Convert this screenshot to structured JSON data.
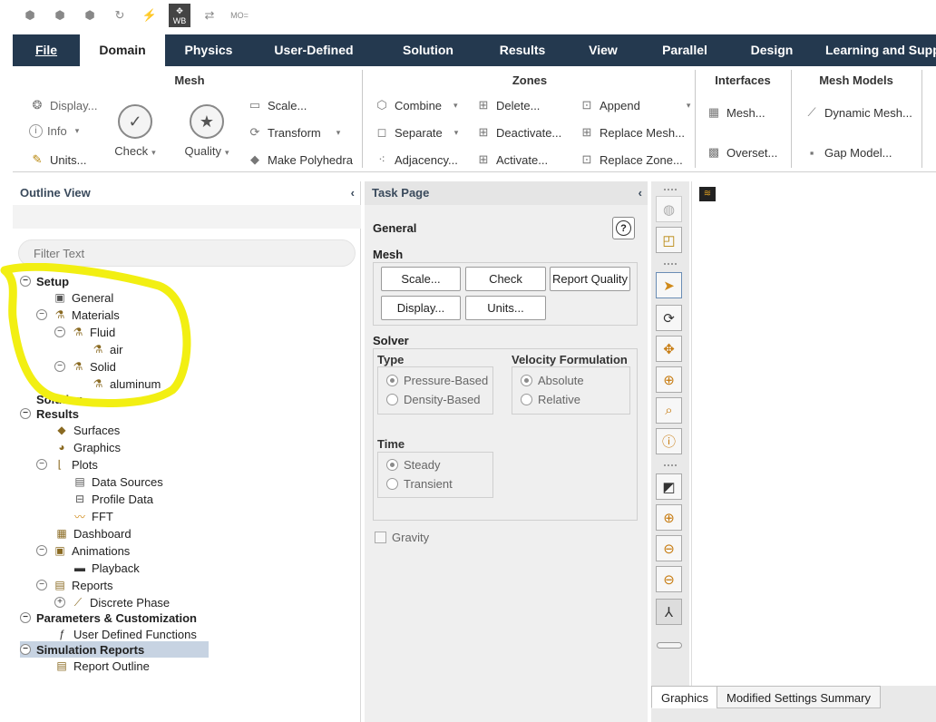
{
  "quick_access": {
    "icons": [
      "new-case-icon",
      "open-case-icon",
      "save-case-icon",
      "refresh-icon",
      "reduce-icon",
      "workbench-icon",
      "layout-icon",
      "moe-icon"
    ],
    "wb_label": "WB",
    "moe_label": "MO="
  },
  "tabs": [
    {
      "label": "File",
      "active": false
    },
    {
      "label": "Domain",
      "active": true
    },
    {
      "label": "Physics",
      "active": false
    },
    {
      "label": "User-Defined",
      "active": false
    },
    {
      "label": "Solution",
      "active": false
    },
    {
      "label": "Results",
      "active": false
    },
    {
      "label": "View",
      "active": false
    },
    {
      "label": "Parallel",
      "active": false
    },
    {
      "label": "Design",
      "active": false
    },
    {
      "label": "Learning and Support",
      "active": false
    }
  ],
  "ribbon": {
    "mesh": {
      "title": "Mesh",
      "display": "Display...",
      "info": "Info",
      "units": "Units...",
      "check": "Check",
      "quality": "Quality",
      "scale": "Scale...",
      "transform": "Transform",
      "make_polyhedra": "Make Polyhedra"
    },
    "zones": {
      "title": "Zones",
      "combine": "Combine",
      "separate": "Separate",
      "adjacency": "Adjacency...",
      "delete": "Delete...",
      "deactivate": "Deactivate...",
      "activate": "Activate...",
      "append": "Append",
      "replace_mesh": "Replace Mesh...",
      "replace_zone": "Replace Zone..."
    },
    "interfaces": {
      "title": "Interfaces",
      "mesh": "Mesh...",
      "overset": "Overset..."
    },
    "mesh_models": {
      "title": "Mesh Models",
      "dynamic_mesh": "Dynamic Mesh...",
      "gap_model": "Gap Model..."
    }
  },
  "outline": {
    "title": "Outline View",
    "filter_placeholder": "Filter Text",
    "tree": {
      "setup": "Setup",
      "general": "General",
      "materials": "Materials",
      "fluid": "Fluid",
      "air": "air",
      "solid": "Solid",
      "aluminum": "aluminum",
      "solution": "Solution",
      "results": "Results",
      "surfaces": "Surfaces",
      "graphics": "Graphics",
      "plots": "Plots",
      "data_sources": "Data Sources",
      "profile_data": "Profile Data",
      "fft": "FFT",
      "dashboard": "Dashboard",
      "animations": "Animations",
      "playback": "Playback",
      "reports": "Reports",
      "discrete_phase": "Discrete Phase",
      "params": "Parameters & Customization",
      "udf": "User Defined Functions",
      "sim_reports": "Simulation Reports",
      "report_outline": "Report Outline"
    }
  },
  "task_page": {
    "title": "Task Page",
    "heading": "General",
    "help": "?",
    "mesh_label": "Mesh",
    "buttons": {
      "scale": "Scale...",
      "check": "Check",
      "report_quality": "Report Quality",
      "display": "Display...",
      "units": "Units..."
    },
    "solver_label": "Solver",
    "type_label": "Type",
    "pressure_based": "Pressure-Based",
    "density_based": "Density-Based",
    "velocity_label": "Velocity Formulation",
    "absolute": "Absolute",
    "relative": "Relative",
    "time_label": "Time",
    "steady": "Steady",
    "transient": "Transient",
    "gravity": "Gravity"
  },
  "bottom_tabs": {
    "graphics": "Graphics",
    "modified": "Modified Settings Summary"
  },
  "colors": {
    "tabbar": "#24394f",
    "annotation": "#f2ef12",
    "selected_row": "#c7d3e2"
  }
}
